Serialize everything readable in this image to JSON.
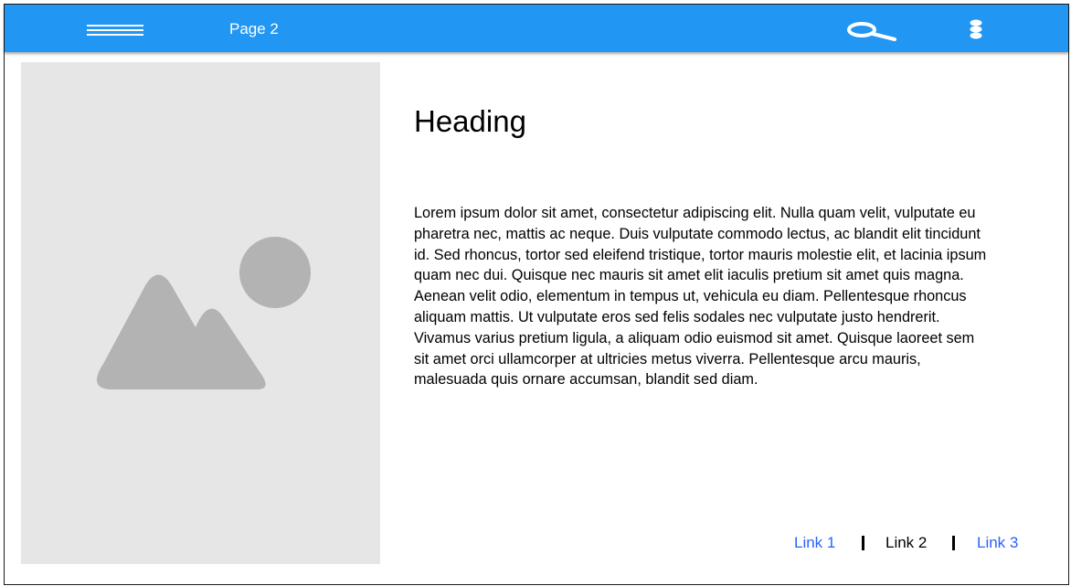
{
  "header": {
    "title": "Page 2",
    "icons": {
      "menu": "hamburger-menu-icon",
      "search": "search-icon",
      "more": "more-vertical-icon"
    },
    "colors": {
      "appbar": "#2196f3",
      "appbar_text": "#ffffff"
    }
  },
  "main": {
    "image": {
      "icon": "image-placeholder-icon",
      "colors": {
        "background": "#e6e6e6",
        "shape": "#b3b3b3"
      }
    },
    "heading": "Heading",
    "body": "Lorem ipsum dolor sit amet, consectetur adipiscing elit. Nulla quam velit, vulputate eu pharetra nec, mattis ac neque. Duis vulputate commodo lectus, ac blandit elit tincidunt id. Sed rhoncus, tortor sed eleifend tristique, tortor mauris molestie elit, et lacinia ipsum quam nec dui. Quisque nec mauris sit amet elit iaculis pretium sit amet quis magna. Aenean velit odio, elementum in tempus ut, vehicula eu diam. Pellentesque rhoncus aliquam mattis. Ut vulputate eros sed felis sodales nec vulputate justo hendrerit. Vivamus varius pretium ligula, a aliquam odio euismod sit amet. Quisque laoreet sem sit amet orci ullamcorper at ultricies metus viverra. Pellentesque arcu mauris, malesuada quis ornare accumsan, blandit sed diam."
  },
  "footer": {
    "links": [
      {
        "label": "Link 1",
        "color": "#2962ff"
      },
      {
        "label": "Link 2",
        "color": "#000000"
      },
      {
        "label": "Link 3",
        "color": "#2962ff"
      }
    ]
  }
}
